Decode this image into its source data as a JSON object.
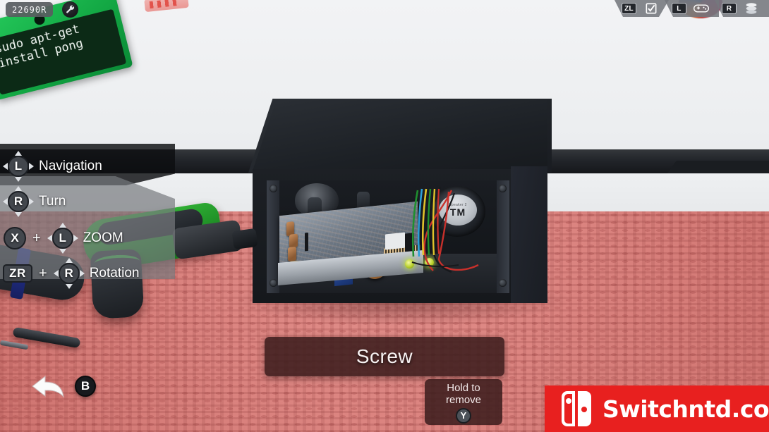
{
  "hud": {
    "id_chip": {
      "label": "22690R",
      "icon": "wrench-icon"
    },
    "top_right": [
      {
        "button": "ZL",
        "icon": "checkbox-checked-icon"
      },
      {
        "button": "L",
        "icon": "gamepad-icon"
      },
      {
        "button": "R",
        "icon": "layers-stack-icon"
      }
    ],
    "controls": [
      {
        "inputs": [
          "L"
        ],
        "combo": false,
        "label": "Navigation",
        "type": "stick"
      },
      {
        "inputs": [
          "R"
        ],
        "combo": false,
        "label": "Turn",
        "type": "stick"
      },
      {
        "inputs": [
          "X",
          "L"
        ],
        "combo": true,
        "label": "ZOOM",
        "type": "button-stick"
      },
      {
        "inputs": [
          "ZR",
          "R"
        ],
        "combo": true,
        "label": "Rotation",
        "type": "pill-stick"
      }
    ],
    "selection": {
      "part_name": "Screw",
      "action_line_1": "Hold to",
      "action_line_2": "remove",
      "action_button": "Y"
    },
    "back": {
      "icon": "back-arrow-icon",
      "button": "B"
    }
  },
  "sign": {
    "line_1": "sudo apt-get",
    "line_2": "install pong"
  },
  "device": {
    "speaker_brand": "Speaker 2",
    "speaker_mark": "TM"
  },
  "watermark": {
    "text": "Switchntd.com",
    "logo": "nintendo-switch-joycon-icon",
    "background": "#e8201f"
  },
  "colors": {
    "sign_green": "#13a844",
    "sign_face": "#0c2a16",
    "bench_red": "#dc8581",
    "panel_dark": "#3e1e1e",
    "hud_gray": "#76797e",
    "accent_screw": "#b9d12c"
  }
}
